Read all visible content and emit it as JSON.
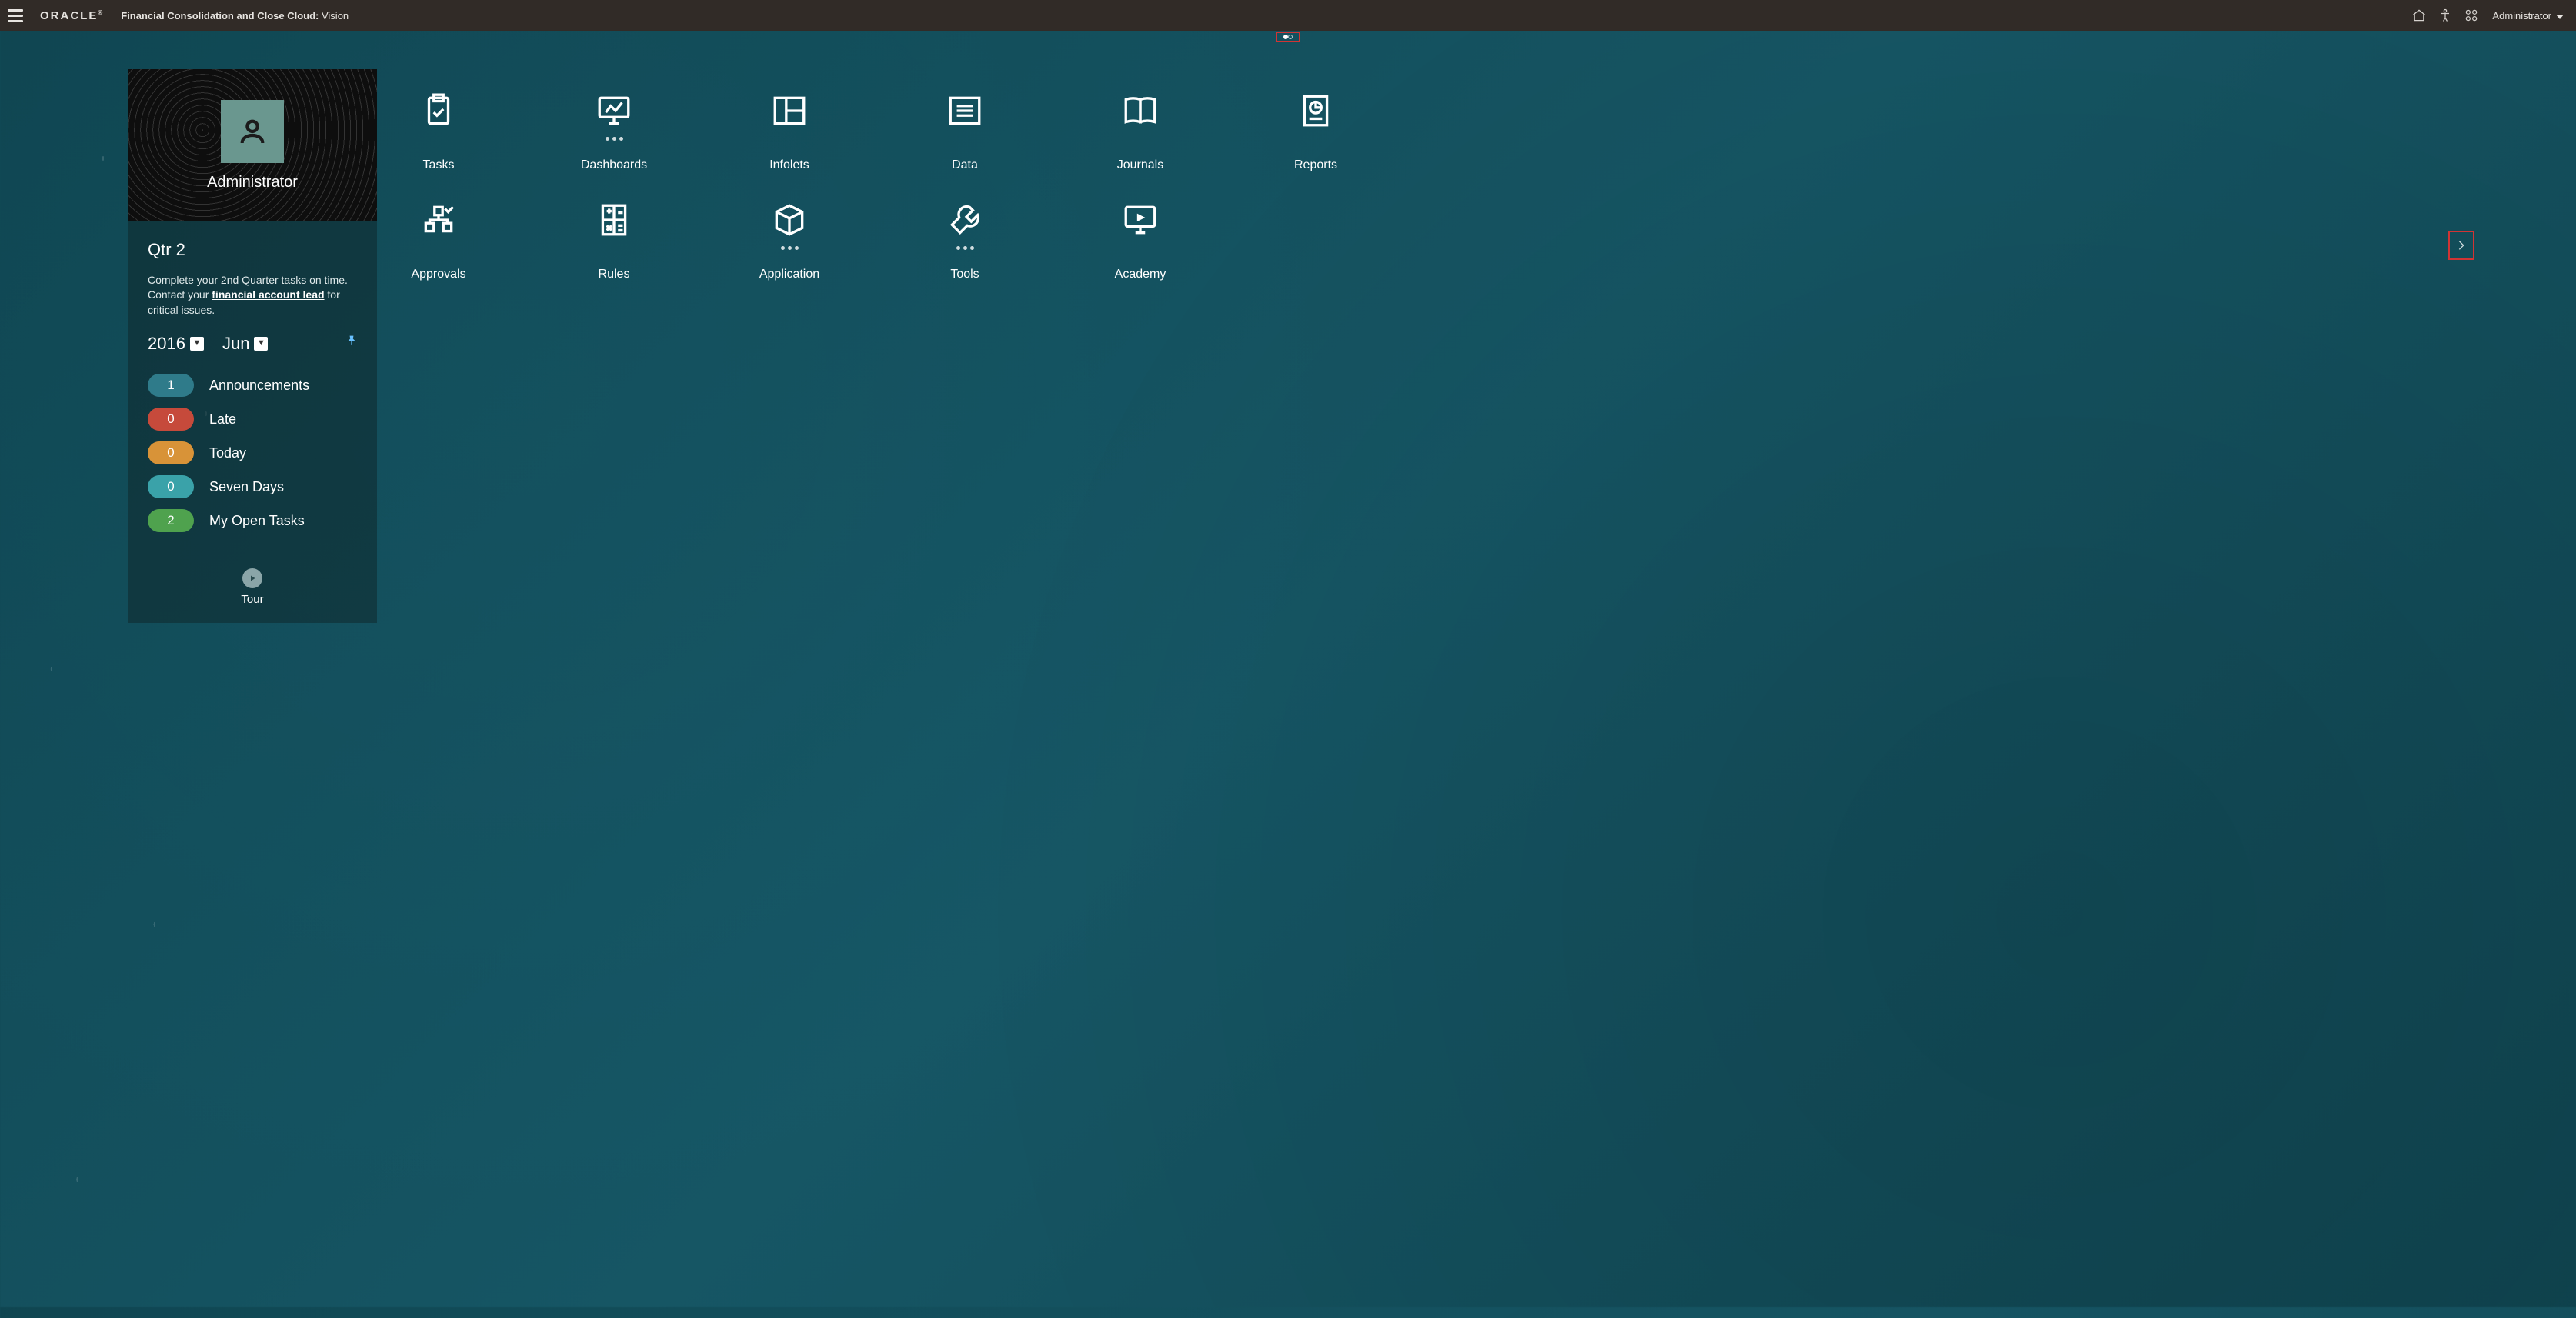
{
  "topbar": {
    "brand": "ORACLE",
    "product_bold": "Financial Consolidation and Close Cloud:",
    "product_rest": " Vision",
    "user_label": "Administrator"
  },
  "page_dots": {
    "count": 2,
    "active_index": 0
  },
  "panel": {
    "username": "Administrator",
    "quarter_title": "Qtr 2",
    "desc_prefix": "Complete your 2nd Quarter tasks on time. Contact your ",
    "desc_link": "financial account lead",
    "desc_suffix": " for critical issues.",
    "year": "2016",
    "month": "Jun",
    "counts": [
      {
        "value": "1",
        "label": "Announcements",
        "color": "blue"
      },
      {
        "value": "0",
        "label": "Late",
        "color": "red"
      },
      {
        "value": "0",
        "label": "Today",
        "color": "orange"
      },
      {
        "value": "0",
        "label": "Seven Days",
        "color": "teal"
      },
      {
        "value": "2",
        "label": "My Open Tasks",
        "color": "green"
      }
    ],
    "tour_label": "Tour"
  },
  "board": {
    "row1": [
      {
        "name": "tasks",
        "label": "Tasks",
        "icon": "clipboard-check",
        "has_dots": false
      },
      {
        "name": "dashboards",
        "label": "Dashboards",
        "icon": "chart-monitor",
        "has_dots": true
      },
      {
        "name": "infolets",
        "label": "Infolets",
        "icon": "layout-panel",
        "has_dots": false
      },
      {
        "name": "data",
        "label": "Data",
        "icon": "list-lines",
        "has_dots": false
      },
      {
        "name": "journals",
        "label": "Journals",
        "icon": "open-book",
        "has_dots": false
      },
      {
        "name": "reports",
        "label": "Reports",
        "icon": "pie-doc",
        "has_dots": false
      }
    ],
    "row2": [
      {
        "name": "approvals",
        "label": "Approvals",
        "icon": "org-check",
        "has_dots": false
      },
      {
        "name": "rules",
        "label": "Rules",
        "icon": "calculator",
        "has_dots": false
      },
      {
        "name": "application",
        "label": "Application",
        "icon": "cube",
        "has_dots": true
      },
      {
        "name": "tools",
        "label": "Tools",
        "icon": "wrench",
        "has_dots": true
      },
      {
        "name": "academy",
        "label": "Academy",
        "icon": "play-monitor",
        "has_dots": false
      }
    ]
  }
}
